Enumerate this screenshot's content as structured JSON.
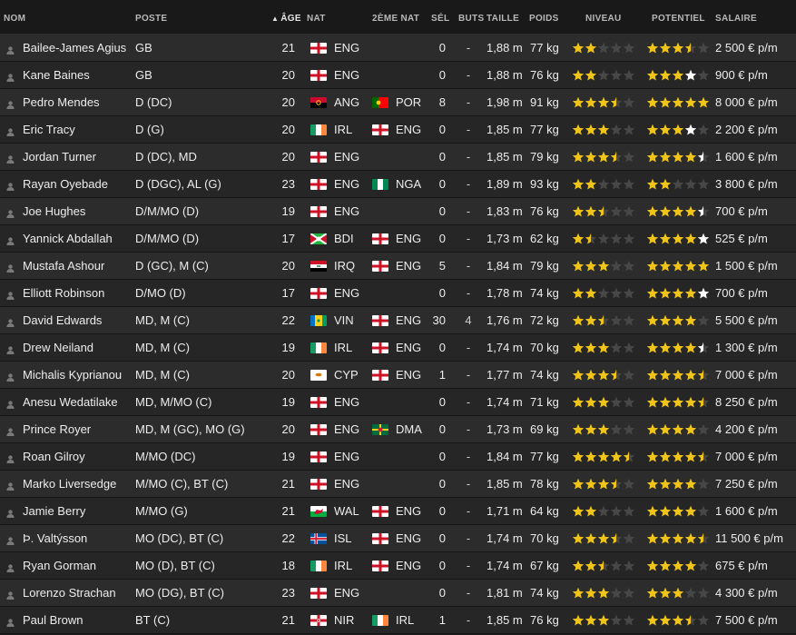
{
  "columns": {
    "nom": "NOM",
    "poste": "POSTE",
    "age": "ÂGE",
    "nat": "NAT",
    "nat2": "2ÈME NAT",
    "sel": "SÉL",
    "buts": "BUTS",
    "taille": "TAILLE",
    "poids": "POIDS",
    "niveau": "NIVEAU",
    "potentiel": "POTENTIEL",
    "salaire": "SALAIRE"
  },
  "sort": {
    "column": "age",
    "direction": "ascending",
    "icon": "sort-up-triangle-icon"
  },
  "colors": {
    "star_filled": "#f0c419",
    "star_empty": "#474747",
    "star_white": "#ffffff",
    "row_odd": "#2c2c2c",
    "row_even": "#262626"
  },
  "players": [
    {
      "name": "Bailee-James Agius",
      "poste": "GB",
      "age": "21",
      "nat": "ENG",
      "nat2": "",
      "sel": "0",
      "buts": "-",
      "taille": "1,88 m",
      "poids": "77 kg",
      "niveau": 2,
      "potentiel_gold": 3.5,
      "potentiel_white": 0,
      "salaire": "2 500 € p/m"
    },
    {
      "name": "Kane Baines",
      "poste": "GB",
      "age": "20",
      "nat": "ENG",
      "nat2": "",
      "sel": "0",
      "buts": "-",
      "taille": "1,88 m",
      "poids": "76 kg",
      "niveau": 2,
      "potentiel_gold": 3,
      "potentiel_white": 1,
      "salaire": "900 € p/m"
    },
    {
      "name": "Pedro Mendes",
      "poste": "D (DC)",
      "age": "20",
      "nat": "ANG",
      "nat2": "POR",
      "sel": "8",
      "buts": "-",
      "taille": "1,98 m",
      "poids": "91 kg",
      "niveau": 3.5,
      "potentiel_gold": 5,
      "potentiel_white": 0,
      "salaire": "8 000 € p/m"
    },
    {
      "name": "Eric Tracy",
      "poste": "D (G)",
      "age": "20",
      "nat": "IRL",
      "nat2": "ENG",
      "sel": "0",
      "buts": "-",
      "taille": "1,85 m",
      "poids": "77 kg",
      "niveau": 3,
      "potentiel_gold": 3,
      "potentiel_white": 1,
      "salaire": "2 200 € p/m"
    },
    {
      "name": "Jordan Turner",
      "poste": "D (DC), MD",
      "age": "20",
      "nat": "ENG",
      "nat2": "",
      "sel": "0",
      "buts": "-",
      "taille": "1,85 m",
      "poids": "79 kg",
      "niveau": 3.5,
      "potentiel_gold": 4,
      "potentiel_white": 0.5,
      "salaire": "1 600 € p/m"
    },
    {
      "name": "Rayan Oyebade",
      "poste": "D (DGC), AL (G)",
      "age": "23",
      "nat": "ENG",
      "nat2": "NGA",
      "sel": "0",
      "buts": "-",
      "taille": "1,89 m",
      "poids": "93 kg",
      "niveau": 2,
      "potentiel_gold": 2,
      "potentiel_white": 0,
      "salaire": "3 800 € p/m"
    },
    {
      "name": "Joe Hughes",
      "poste": "D/M/MO (D)",
      "age": "19",
      "nat": "ENG",
      "nat2": "",
      "sel": "0",
      "buts": "-",
      "taille": "1,83 m",
      "poids": "76 kg",
      "niveau": 2.5,
      "potentiel_gold": 4,
      "potentiel_white": 0.5,
      "salaire": "700 € p/m"
    },
    {
      "name": "Yannick Abdallah",
      "poste": "D/M/MO (D)",
      "age": "17",
      "nat": "BDI",
      "nat2": "ENG",
      "sel": "0",
      "buts": "-",
      "taille": "1,73 m",
      "poids": "62 kg",
      "niveau": 1.5,
      "potentiel_gold": 4,
      "potentiel_white": 1,
      "salaire": "525 € p/m"
    },
    {
      "name": "Mustafa Ashour",
      "poste": "D (GC), M (C)",
      "age": "20",
      "nat": "IRQ",
      "nat2": "ENG",
      "sel": "5",
      "buts": "-",
      "taille": "1,84 m",
      "poids": "79 kg",
      "niveau": 3,
      "potentiel_gold": 5,
      "potentiel_white": 0,
      "salaire": "1 500 € p/m"
    },
    {
      "name": "Elliott Robinson",
      "poste": "D/MO (D)",
      "age": "17",
      "nat": "ENG",
      "nat2": "",
      "sel": "0",
      "buts": "-",
      "taille": "1,78 m",
      "poids": "74 kg",
      "niveau": 2,
      "potentiel_gold": 4,
      "potentiel_white": 1,
      "salaire": "700 € p/m"
    },
    {
      "name": "David Edwards",
      "poste": "MD, M (C)",
      "age": "22",
      "nat": "VIN",
      "nat2": "ENG",
      "sel": "30",
      "buts": "4",
      "taille": "1,76 m",
      "poids": "72 kg",
      "niveau": 2.5,
      "potentiel_gold": 4,
      "potentiel_white": 0,
      "salaire": "5 500 € p/m"
    },
    {
      "name": "Drew Neiland",
      "poste": "MD, M (C)",
      "age": "19",
      "nat": "IRL",
      "nat2": "ENG",
      "sel": "0",
      "buts": "-",
      "taille": "1,74 m",
      "poids": "70 kg",
      "niveau": 3,
      "potentiel_gold": 4,
      "potentiel_white": 0.5,
      "salaire": "1 300 € p/m"
    },
    {
      "name": "Michalis Kyprianou",
      "poste": "MD, M (C)",
      "age": "20",
      "nat": "CYP",
      "nat2": "ENG",
      "sel": "1",
      "buts": "-",
      "taille": "1,77 m",
      "poids": "74 kg",
      "niveau": 3.5,
      "potentiel_gold": 4.5,
      "potentiel_white": 0,
      "salaire": "7 000 € p/m"
    },
    {
      "name": "Anesu Wedatilake",
      "poste": "MD, M/MO (C)",
      "age": "19",
      "nat": "ENG",
      "nat2": "",
      "sel": "0",
      "buts": "-",
      "taille": "1,74 m",
      "poids": "71 kg",
      "niveau": 3,
      "potentiel_gold": 4.5,
      "potentiel_white": 0,
      "salaire": "8 250 € p/m"
    },
    {
      "name": "Prince Royer",
      "poste": "MD, M (GC), MO (G)",
      "age": "20",
      "nat": "ENG",
      "nat2": "DMA",
      "sel": "0",
      "buts": "-",
      "taille": "1,73 m",
      "poids": "69 kg",
      "niveau": 3,
      "potentiel_gold": 4,
      "potentiel_white": 0,
      "salaire": "4 200 € p/m"
    },
    {
      "name": "Roan Gilroy",
      "poste": "M/MO (DC)",
      "age": "19",
      "nat": "ENG",
      "nat2": "",
      "sel": "0",
      "buts": "-",
      "taille": "1,84 m",
      "poids": "77 kg",
      "niveau": 4.5,
      "potentiel_gold": 4.5,
      "potentiel_white": 0,
      "salaire": "7 000 € p/m"
    },
    {
      "name": "Marko Liversedge",
      "poste": "M/MO (C), BT (C)",
      "age": "21",
      "nat": "ENG",
      "nat2": "",
      "sel": "0",
      "buts": "-",
      "taille": "1,85 m",
      "poids": "78 kg",
      "niveau": 3.5,
      "potentiel_gold": 4,
      "potentiel_white": 0,
      "salaire": "7 250 € p/m"
    },
    {
      "name": "Jamie Berry",
      "poste": "M/MO (G)",
      "age": "21",
      "nat": "WAL",
      "nat2": "ENG",
      "sel": "0",
      "buts": "-",
      "taille": "1,71 m",
      "poids": "64 kg",
      "niveau": 2,
      "potentiel_gold": 4,
      "potentiel_white": 0,
      "salaire": "1 600 € p/m"
    },
    {
      "name": "Þ. Valtýsson",
      "poste": "MO (DC), BT (C)",
      "age": "22",
      "nat": "ISL",
      "nat2": "ENG",
      "sel": "0",
      "buts": "-",
      "taille": "1,74 m",
      "poids": "70 kg",
      "niveau": 3.5,
      "potentiel_gold": 4.5,
      "potentiel_white": 0,
      "salaire": "11 500 € p/m"
    },
    {
      "name": "Ryan Gorman",
      "poste": "MO (D), BT (C)",
      "age": "18",
      "nat": "IRL",
      "nat2": "ENG",
      "sel": "0",
      "buts": "-",
      "taille": "1,74 m",
      "poids": "67 kg",
      "niveau": 2.5,
      "potentiel_gold": 4,
      "potentiel_white": 0,
      "salaire": "675 € p/m"
    },
    {
      "name": "Lorenzo Strachan",
      "poste": "MO (DG), BT (C)",
      "age": "23",
      "nat": "ENG",
      "nat2": "",
      "sel": "0",
      "buts": "-",
      "taille": "1,81 m",
      "poids": "74 kg",
      "niveau": 3,
      "potentiel_gold": 3,
      "potentiel_white": 0,
      "salaire": "4 300 € p/m"
    },
    {
      "name": "Paul Brown",
      "poste": "BT (C)",
      "age": "21",
      "nat": "NIR",
      "nat2": "IRL",
      "sel": "1",
      "buts": "-",
      "taille": "1,85 m",
      "poids": "76 kg",
      "niveau": 3,
      "potentiel_gold": 3.5,
      "potentiel_white": 0,
      "salaire": "7 500 € p/m"
    }
  ]
}
